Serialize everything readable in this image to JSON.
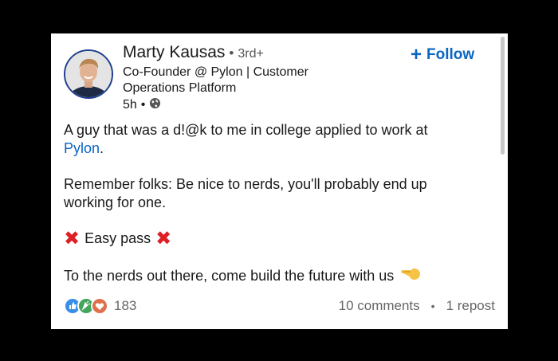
{
  "post": {
    "author": {
      "name": "Marty Kausas",
      "degree": "3rd+",
      "headline": "Co-Founder @ Pylon | Customer Operations Platform",
      "time": "5h",
      "visibility_icon": "globe-icon"
    },
    "follow_label": "Follow",
    "body": {
      "line1": "A guy that was a d!@k to me in college applied to work at",
      "link_text": "Pylon",
      "line1_end": ".",
      "line2": "Remember folks: Be nice to nerds, you'll probably end up working for one.",
      "line3": "Easy pass",
      "line4": "To the nerds out there, come build the future with us"
    },
    "reactions": {
      "icons": [
        "like-icon",
        "celebrate-icon",
        "love-icon"
      ],
      "count": "183"
    },
    "comments": "10 comments",
    "reposts": "1 repost"
  },
  "colors": {
    "accent": "#0a66c2",
    "x_mark": "#dd1f26"
  }
}
